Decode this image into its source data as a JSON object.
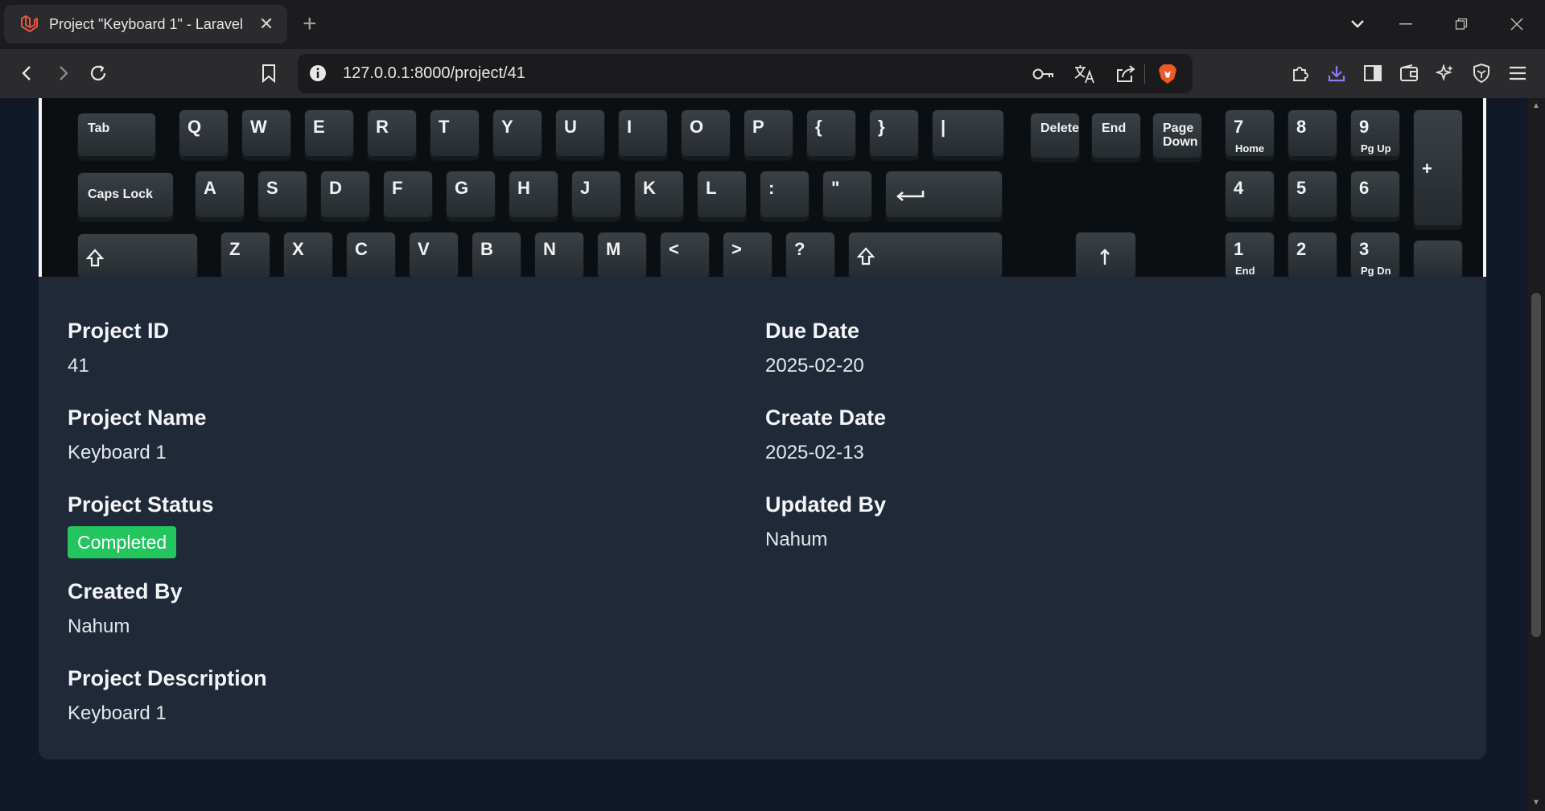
{
  "browser": {
    "tab_title": "Project \"Keyboard 1\" - Laravel",
    "url": "127.0.0.1:8000/project/41"
  },
  "keyboard_keys": {
    "row1": [
      "Tab",
      "Q",
      "W",
      "E",
      "R",
      "T",
      "Y",
      "U",
      "I",
      "O",
      "P",
      "{",
      "}",
      "|",
      "Delete",
      "End",
      "Page Down",
      "7",
      "8",
      "9",
      "+"
    ],
    "row2": [
      "Caps Lock",
      "A",
      "S",
      "D",
      "F",
      "G",
      "H",
      "J",
      "K",
      "L",
      ":",
      "\"",
      "4",
      "5",
      "6"
    ],
    "row3": [
      "Z",
      "X",
      "C",
      "V",
      "B",
      "N",
      "M",
      "<",
      ">",
      "?",
      "1",
      "2",
      "3"
    ],
    "nav_labels": [
      "Home",
      "Pg Up",
      "End",
      "Pg Dn"
    ]
  },
  "project": {
    "id_label": "Project ID",
    "id_value": "41",
    "name_label": "Project Name",
    "name_value": "Keyboard 1",
    "status_label": "Project Status",
    "status_value": "Completed",
    "created_by_label": "Created By",
    "created_by_value": "Nahum",
    "description_label": "Project Description",
    "description_value": "Keyboard 1",
    "due_date_label": "Due Date",
    "due_date_value": "2025-02-20",
    "create_date_label": "Create Date",
    "create_date_value": "2025-02-13",
    "updated_by_label": "Updated By",
    "updated_by_value": "Nahum"
  },
  "colors": {
    "status_completed": "#22c55e",
    "card": "#1f2937",
    "page": "#111827"
  }
}
